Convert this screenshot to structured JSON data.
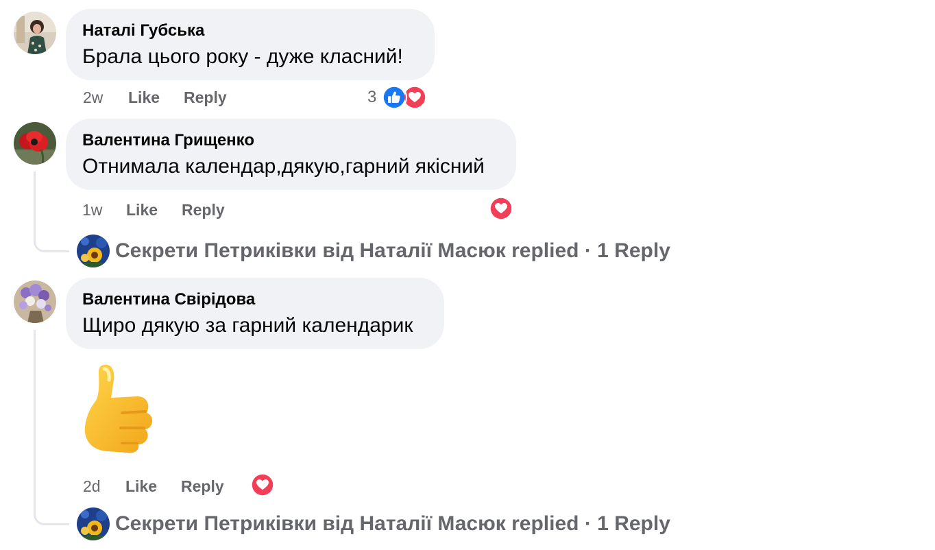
{
  "comments": [
    {
      "author": "Наталі Губська",
      "text": "Брала цього року - дуже класний!",
      "time": "2w",
      "like_label": "Like",
      "reply_label": "Reply",
      "reaction_count": "3",
      "reactions": [
        "like-icon",
        "love-icon"
      ],
      "avatar": "avatar-woman-photo"
    },
    {
      "author": "Валентина Грищенко",
      "text": "Отнимала календар,дякую,гарний якісний",
      "time": "1w",
      "like_label": "Like",
      "reply_label": "Reply",
      "reactions": [
        "love-icon"
      ],
      "avatar": "avatar-poppy-photo",
      "replies_summary": {
        "author": "Секрети Петриківки від Наталії Масюк",
        "action": "replied",
        "separator": "·",
        "count_label": "1 Reply"
      }
    },
    {
      "author": "Валентина Свірідова",
      "text": "Щиро дякую за гарний календарик",
      "sticker": "thumbs-up-sticker",
      "time": "2d",
      "like_label": "Like",
      "reply_label": "Reply",
      "reactions": [
        "love-icon"
      ],
      "avatar": "avatar-flowers-photo",
      "replies_summary": {
        "author": "Секрети Петриківки від Наталії Масюк",
        "action": "replied",
        "separator": "·",
        "count_label": "1 Reply"
      }
    }
  ],
  "colors": {
    "bubble_bg": "#f0f2f5",
    "secondary_text": "#65676b",
    "like_blue": "#1877f2",
    "love_red": "#f33e58",
    "thread_line": "#e4e6eb"
  }
}
